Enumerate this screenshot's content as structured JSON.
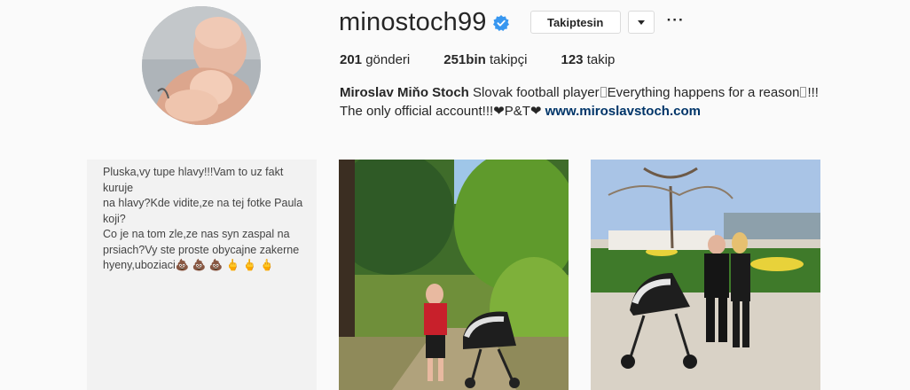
{
  "profile": {
    "username": "minostoch99",
    "follow_label": "Takiptesin",
    "stats": {
      "posts": "201",
      "posts_label": "gönderi",
      "followers": "251bin",
      "followers_label": "takipçi",
      "following": "123",
      "following_label": "takip"
    },
    "bio": {
      "full_name": "Miroslav Miňo Stoch",
      "text_1": "Slovak football player",
      "text_2": "Everything happens for a reason",
      "text_3": "!!! The only official account!!!❤P&T❤",
      "website": "www.miroslavstoch.com"
    }
  },
  "posts": [
    {
      "text": "Pluska,vy tupe hlavy!!!Vam to uz fakt kuruje\nna hlavy?Kde vidite,ze na tej fotke Paula koji?\nCo je na tom zle,ze nas syn zaspal na\nprsiach?Vy ste proste obycajne zakerne\nhyeny,uboziaci💩 💩 💩 🖕 🖕 🖕"
    },
    {
      "icon": "photo"
    },
    {
      "icon": "photo"
    }
  ],
  "colors": {
    "verified": "#3897f0",
    "link": "#003569",
    "background": "#fafafa"
  }
}
